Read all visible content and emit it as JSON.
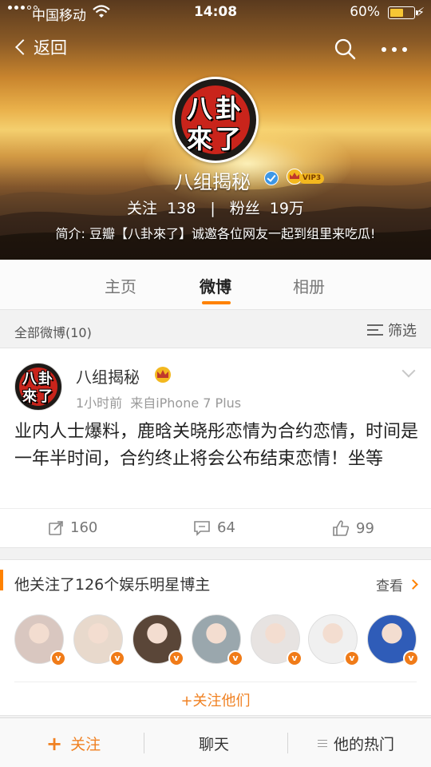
{
  "status_bar": {
    "carrier": "中国移动",
    "time": "14:08",
    "battery_percent": "60%",
    "battery_level": 0.6
  },
  "nav": {
    "back_label": "返回",
    "search_icon": "search-icon",
    "more_icon": "more-icon"
  },
  "profile": {
    "logo_line1": "八卦",
    "logo_line2": "來了",
    "name": "八组揭秘",
    "vip_label": "VIP3",
    "following_label": "关注",
    "following_count": "138",
    "followers_label": "粉丝",
    "followers_count": "19万",
    "intro": "简介: 豆瓣【八卦來了】诚邀各位网友一起到组里来吃瓜!"
  },
  "tabs": [
    {
      "label": "主页",
      "active": false
    },
    {
      "label": "微博",
      "active": true
    },
    {
      "label": "相册",
      "active": false
    }
  ],
  "filter": {
    "all_posts": "全部微博(10)",
    "filter_label": "筛选"
  },
  "post": {
    "author": "八组揭秘",
    "time": "1小时前",
    "source": "来自iPhone 7 Plus",
    "text": "业内人士爆料，鹿晗关晓彤恋情为合约恋情，时间是一年半时间，合约终止将会公布结束恋情！坐等",
    "reposts": "160",
    "comments": "64",
    "likes": "99"
  },
  "follows": {
    "title": "他关注了126个娱乐明星博主",
    "view_more": "查看",
    "follow_all": "+关注他们",
    "avatars": [
      {
        "icon": "celebrity-avatar-1",
        "color": "#d9c7c0"
      },
      {
        "icon": "celebrity-avatar-2",
        "color": "#e8d9cc"
      },
      {
        "icon": "celebrity-avatar-3",
        "color": "#5a4638"
      },
      {
        "icon": "celebrity-avatar-4",
        "color": "#9aa7ad"
      },
      {
        "icon": "celebrity-avatar-5",
        "color": "#e7e3e1"
      },
      {
        "icon": "celebrity-avatar-6",
        "color": "#f0f0f0"
      },
      {
        "icon": "celebrity-avatar-7",
        "color": "#2f5cb8"
      }
    ]
  },
  "bottom_bar": {
    "follow_label": "关注",
    "chat_label": "聊天",
    "hot_label": "他的热门"
  },
  "colors": {
    "accent": "#ff8200",
    "verified": "#3d97e6",
    "vip": "#f3b81f"
  }
}
